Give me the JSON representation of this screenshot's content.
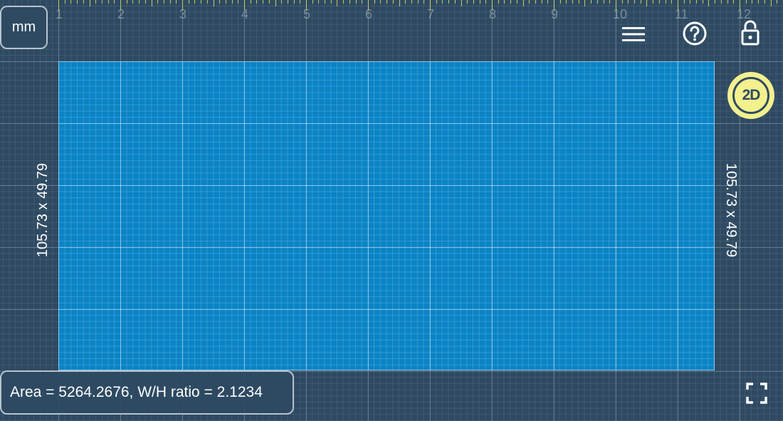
{
  "ruler": {
    "numbers": [
      "1",
      "2",
      "3",
      "4",
      "5",
      "6",
      "7",
      "8",
      "9",
      "10",
      "11",
      "12"
    ]
  },
  "toolbar": {
    "unit_label": "mm",
    "menu_icon": "hamburger-menu-icon",
    "help_icon": "question-circle-icon",
    "lock_icon": "unlocked-padlock-icon",
    "fullscreen_icon": "fullscreen-corners-icon"
  },
  "rectangle": {
    "dimension_left": "105.73 x 49.79",
    "dimension_right": "105.73 x 49.79"
  },
  "mode_badge": {
    "label": "2D"
  },
  "status": {
    "text": "Area = 5264.2676, W/H ratio = 2.1234"
  },
  "colors": {
    "background": "#2e4a62",
    "rectangle_fill": "#0a84c6",
    "badge": "#f3f08e",
    "ruler_ticks": "#c8c45a"
  }
}
